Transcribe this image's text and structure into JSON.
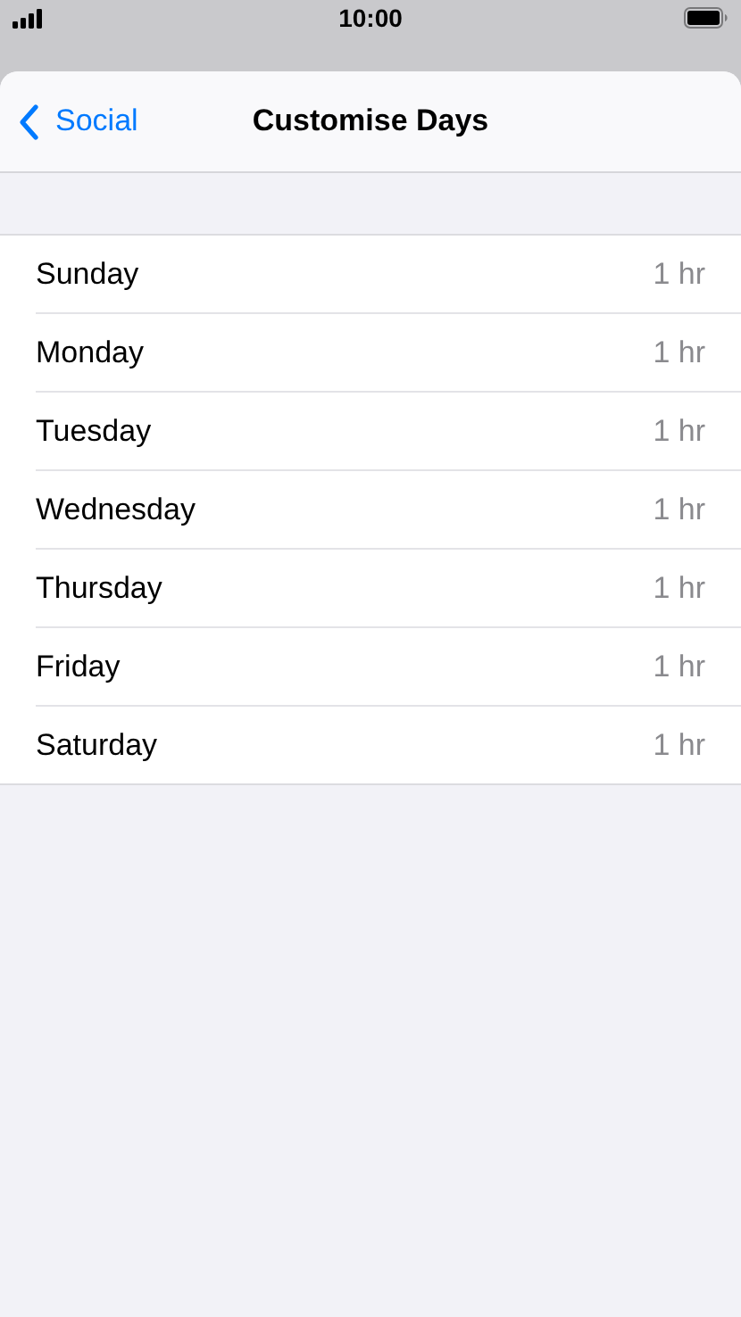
{
  "status_bar": {
    "time": "10:00"
  },
  "nav": {
    "back_label": "Social",
    "title": "Customise Days"
  },
  "days": [
    {
      "label": "Sunday",
      "value": "1 hr"
    },
    {
      "label": "Monday",
      "value": "1 hr"
    },
    {
      "label": "Tuesday",
      "value": "1 hr"
    },
    {
      "label": "Wednesday",
      "value": "1 hr"
    },
    {
      "label": "Thursday",
      "value": "1 hr"
    },
    {
      "label": "Friday",
      "value": "1 hr"
    },
    {
      "label": "Saturday",
      "value": "1 hr"
    }
  ]
}
